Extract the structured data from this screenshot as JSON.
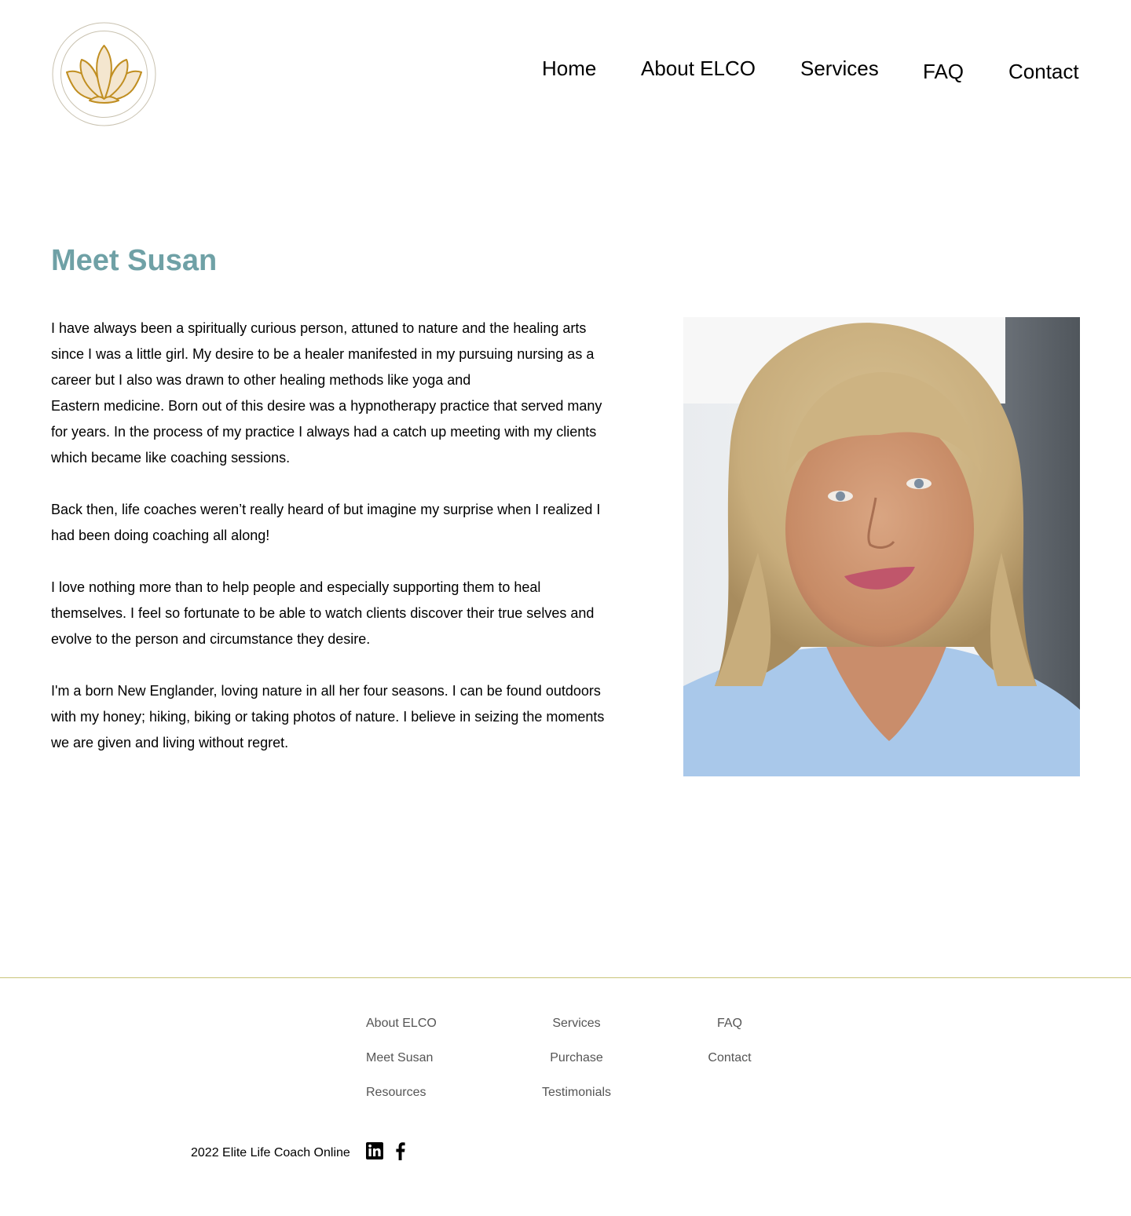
{
  "header": {
    "logo_icon": "lotus-logo-icon",
    "nav": {
      "home": "Home",
      "about": "About ELCO",
      "services": "Services",
      "faq": "FAQ",
      "contact": "Contact"
    }
  },
  "main": {
    "title": "Meet Susan",
    "paragraphs": [
      "I have always been a spiritually curious person, attuned to nature and the healing arts since I was a little girl. My desire to be a healer manifested in my pursuing nursing as a career but I also was drawn to other healing methods like yoga and",
      "Eastern medicine. Born out of this desire was a hypnotherapy practice that served many for years. In the process of my practice I always had a catch up meeting with my clients which became like coaching sessions.",
      "Back then, life coaches weren’t really heard of but imagine my surprise when I realized I had been doing coaching all along!",
      "I love nothing more than to help people and especially supporting them to heal themselves. I feel so fortunate to be able to watch clients discover their true selves and evolve to the person and circumstance they desire.",
      "I'm a born New Englander, loving nature in all her four seasons. I can be found outdoors with my honey; hiking, biking or taking photos of nature. I believe in seizing the moments we are given and living without regret."
    ],
    "photo_icon": "portrait-photo"
  },
  "footer": {
    "links": {
      "about": "About ELCO",
      "services": "Services",
      "faq": "FAQ",
      "meet_susan": "Meet Susan",
      "purchase": "Purchase",
      "contact": "Contact",
      "resources": "Resources",
      "testimonials": "Testimonials"
    },
    "copyright": "2022 Elite Life Coach Online",
    "social_icons": [
      "linkedin-icon",
      "facebook-icon"
    ]
  },
  "colors": {
    "title": "#6fa1a6",
    "logo_gold": "#c08e21",
    "footer_rule": "#c9c47a",
    "footer_link": "#555555"
  }
}
